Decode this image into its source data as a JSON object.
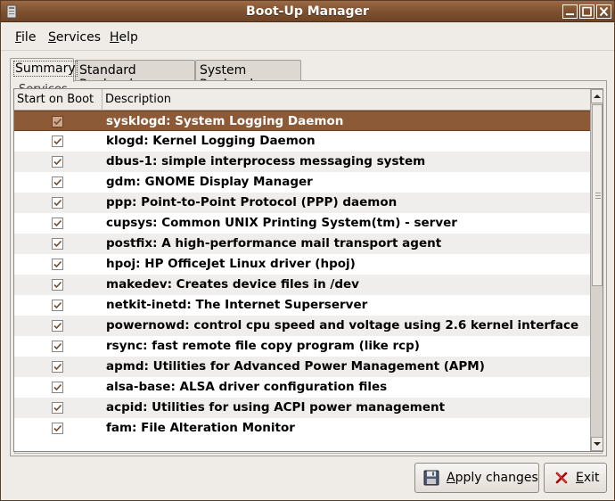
{
  "window": {
    "title": "Boot-Up Manager"
  },
  "menubar": [
    {
      "label": "File",
      "mnemonic": "F",
      "rest": "ile"
    },
    {
      "label": "Services",
      "mnemonic": "S",
      "rest": "ervices"
    },
    {
      "label": "Help",
      "mnemonic": "H",
      "rest": "elp"
    }
  ],
  "tabs": [
    "Summary",
    "Standard Runlevels",
    "System Runlevel"
  ],
  "active_tab": "Summary",
  "frame": {
    "label": "Services"
  },
  "table": {
    "columns": [
      "Start on Boot",
      "Description"
    ],
    "selected_row": 0,
    "rows": [
      {
        "checked": true,
        "text": "sysklogd:  System Logging Daemon"
      },
      {
        "checked": true,
        "text": "klogd:  Kernel Logging Daemon"
      },
      {
        "checked": true,
        "text": "dbus-1:  simple interprocess messaging system"
      },
      {
        "checked": true,
        "text": "gdm:  GNOME Display Manager"
      },
      {
        "checked": true,
        "text": "ppp:  Point-to-Point Protocol (PPP) daemon"
      },
      {
        "checked": true,
        "text": "cupsys:  Common UNIX Printing System(tm) - server"
      },
      {
        "checked": true,
        "text": "postfix:  A high-performance mail transport agent"
      },
      {
        "checked": true,
        "text": "hpoj:  HP OfficeJet Linux driver (hpoj)"
      },
      {
        "checked": true,
        "text": "makedev:  Creates device files in /dev"
      },
      {
        "checked": true,
        "text": "netkit-inetd:  The Internet Superserver"
      },
      {
        "checked": true,
        "text": "powernowd:  control cpu speed and voltage using 2.6 kernel interface"
      },
      {
        "checked": true,
        "text": "rsync:  fast remote file copy program (like rcp)"
      },
      {
        "checked": true,
        "text": "apmd:  Utilities for Advanced Power Management (APM)"
      },
      {
        "checked": true,
        "text": "alsa-base:  ALSA driver configuration files"
      },
      {
        "checked": true,
        "text": "acpid:  Utilities for using ACPI power management"
      },
      {
        "checked": true,
        "text": "fam:  File Alteration Monitor"
      }
    ]
  },
  "buttons": {
    "apply": {
      "mnemonic": "A",
      "rest": "pply changes",
      "icon": "save-icon"
    },
    "exit": {
      "mnemonic": "E",
      "rest": "xit",
      "icon": "close-x-icon"
    }
  },
  "colors": {
    "titlebar": "#7c4f2e",
    "selection": "#8c5a36",
    "window_bg": "#efebe7"
  }
}
